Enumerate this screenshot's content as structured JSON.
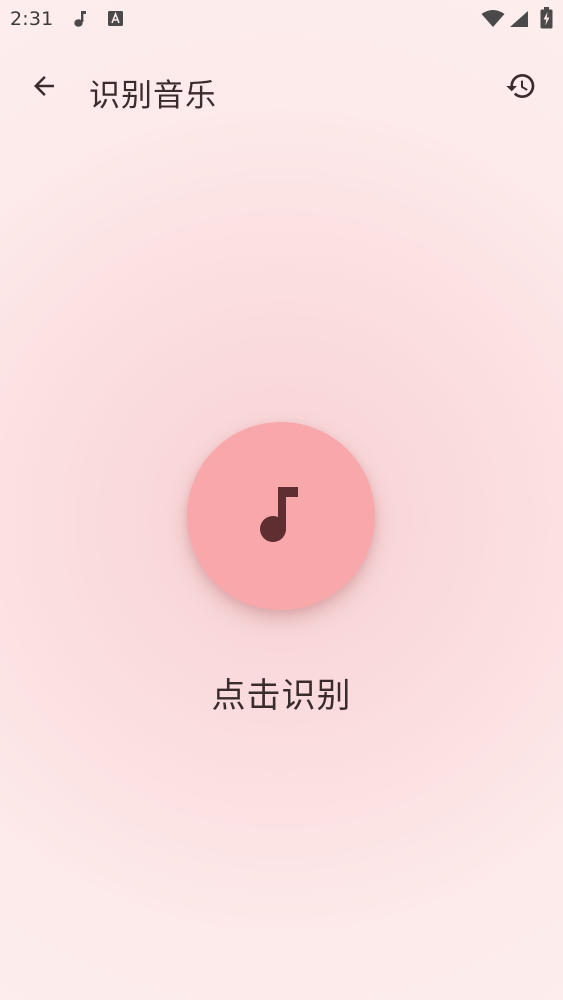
{
  "status_bar": {
    "time": "2:31",
    "notification_icons": [
      "music-note-icon",
      "text-a-icon"
    ],
    "system_icons": [
      "wifi-icon",
      "cellular-signal-icon",
      "battery-icon"
    ]
  },
  "app_bar": {
    "title": "识别音乐",
    "back_icon": "arrow-back-icon",
    "history_icon": "history-icon"
  },
  "main": {
    "action_icon": "music-note-icon",
    "action_label": "点击识别"
  },
  "colors": {
    "background": "#FCE9E9",
    "button_fill": "#F8A8AB",
    "icon_dark": "#5E2E30",
    "text": "#3A2B2D"
  }
}
